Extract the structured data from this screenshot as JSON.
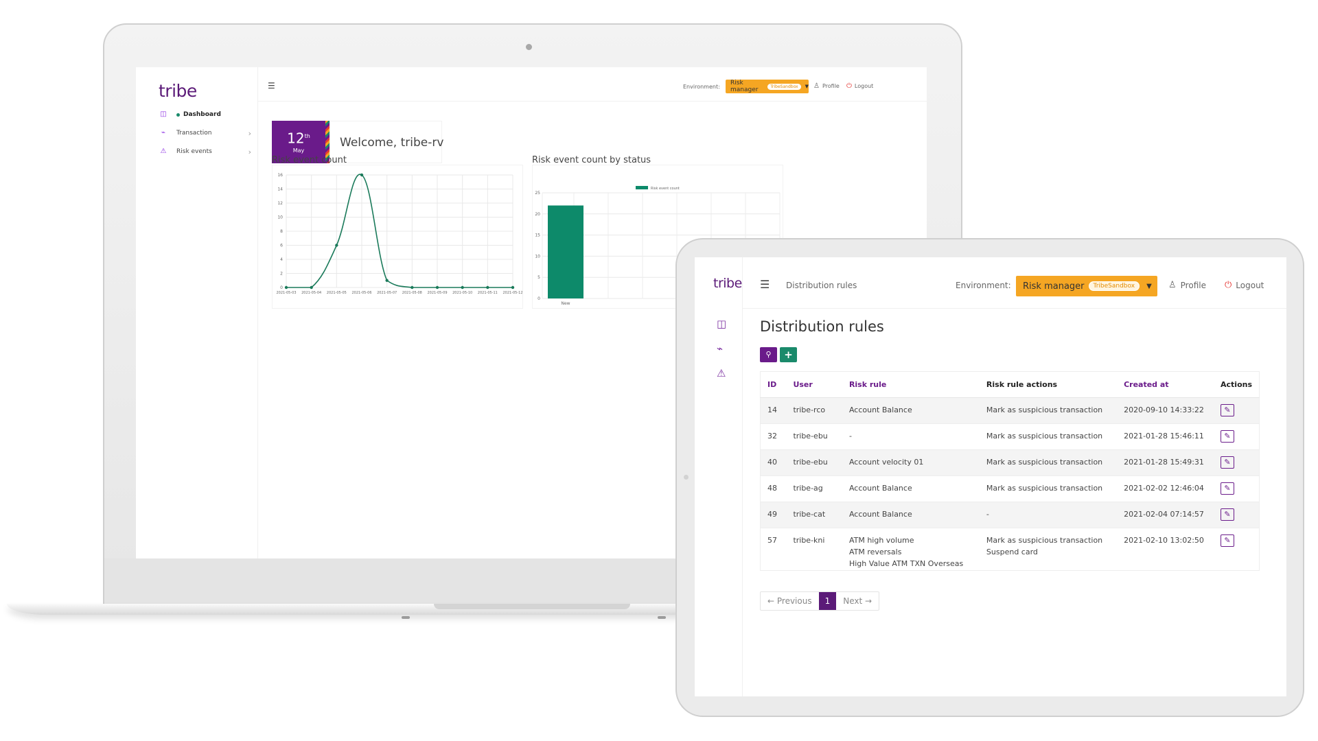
{
  "laptop": {
    "logo": "tribe",
    "nav": [
      {
        "label": "Dashboard",
        "icon": "dashboard-icon",
        "active": true
      },
      {
        "label": "Transaction",
        "icon": "activity-icon",
        "active": false
      },
      {
        "label": "Risk events",
        "icon": "warning-icon",
        "active": false
      }
    ],
    "header": {
      "environment_label": "Environment:",
      "environment_value": "Risk manager",
      "environment_badge": "TribeSandbox",
      "profile": "Profile",
      "logout": "Logout"
    },
    "date": {
      "day": "12",
      "suffix": "th",
      "month": "May"
    },
    "welcome": "Welcome, tribe-rv",
    "panels": {
      "risk_count_title": "Risk event count",
      "risk_status_title": "Risk event count by status"
    }
  },
  "chart_data": [
    {
      "type": "line",
      "title": "Risk event count",
      "x": [
        "2021-05-03",
        "2021-05-04",
        "2021-05-05",
        "2021-05-06",
        "2021-05-07",
        "2021-05-08",
        "2021-05-09",
        "2021-05-10",
        "2021-05-11",
        "2021-05-12"
      ],
      "series": [
        {
          "values": [
            0,
            0,
            6,
            16,
            1,
            0,
            0,
            0,
            0,
            0
          ]
        }
      ],
      "yticks": [
        0,
        2,
        4,
        6,
        8,
        10,
        12,
        14,
        16
      ],
      "ylim": [
        0,
        16
      ],
      "grid": true,
      "color": "#1a7a5a"
    },
    {
      "type": "bar",
      "title": "Risk event count by status",
      "categories": [
        "New"
      ],
      "series": [
        {
          "name": "Risk event count",
          "values": [
            22
          ]
        }
      ],
      "yticks": [
        0,
        5,
        10,
        15,
        20,
        25
      ],
      "ylim": [
        0,
        25
      ],
      "grid": true,
      "legend": "top",
      "color": "#0d8a6a"
    }
  ],
  "tablet": {
    "logo": "tribe",
    "breadcrumb": "Distribution rules",
    "header": {
      "environment_label": "Environment:",
      "environment_value": "Risk manager",
      "environment_badge": "TribeSandbox",
      "profile": "Profile",
      "logout": "Logout"
    },
    "title": "Distribution rules",
    "table": {
      "columns": [
        "ID",
        "User",
        "Risk rule",
        "Risk rule actions",
        "Created at",
        "Actions"
      ],
      "rows": [
        {
          "id": "14",
          "user": "tribe-rco",
          "rule": [
            "Account Balance"
          ],
          "actions": [
            "Mark as suspicious transaction"
          ],
          "created": "2020-09-10 14:33:22"
        },
        {
          "id": "32",
          "user": "tribe-ebu",
          "rule": [
            "-"
          ],
          "actions": [
            "Mark as suspicious transaction"
          ],
          "created": "2021-01-28 15:46:11"
        },
        {
          "id": "40",
          "user": "tribe-ebu",
          "rule": [
            "Account velocity 01"
          ],
          "actions": [
            "Mark as suspicious transaction"
          ],
          "created": "2021-01-28 15:49:31"
        },
        {
          "id": "48",
          "user": "tribe-ag",
          "rule": [
            "Account Balance"
          ],
          "actions": [
            "Mark as suspicious transaction"
          ],
          "created": "2021-02-02 12:46:04"
        },
        {
          "id": "49",
          "user": "tribe-cat",
          "rule": [
            "Account Balance"
          ],
          "actions": [
            "-"
          ],
          "created": "2021-02-04 07:14:57"
        },
        {
          "id": "57",
          "user": "tribe-kni",
          "rule": [
            "ATM high volume",
            "ATM reversals",
            "High Value ATM TXN Overseas"
          ],
          "actions": [
            "Mark as suspicious transaction",
            "Suspend card"
          ],
          "created": "2021-02-10 13:02:50"
        }
      ]
    },
    "pagination": {
      "previous": "← Previous",
      "current": "1",
      "next": "Next →"
    }
  }
}
